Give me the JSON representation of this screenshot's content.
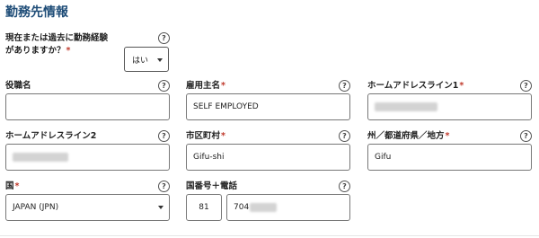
{
  "section": {
    "title": "勤務先情報"
  },
  "experience": {
    "label_line1": "現在または過去に勤務経験",
    "label_line2": "がありますか？",
    "required": "*",
    "value": "はい"
  },
  "fields": {
    "job_title": {
      "label": "役職名",
      "value": ""
    },
    "employer_name": {
      "label": "雇用主名",
      "required": "*",
      "value": "SELF EMPLOYED"
    },
    "address_line1": {
      "label": "ホームアドレスライン1",
      "required": "*"
    },
    "address_line2": {
      "label": "ホームアドレスライン2"
    },
    "city": {
      "label": "市区町村",
      "required": "*",
      "value": "Gifu-shi"
    },
    "state": {
      "label": "州／都道府県／地方",
      "required": "*",
      "value": "Gifu"
    },
    "country": {
      "label": "国",
      "required": "*",
      "value": "JAPAN (JPN)"
    },
    "phone": {
      "label": "国番号＋電話",
      "country_code": "81",
      "number_prefix": "704"
    }
  },
  "help_icon_glyph": "?",
  "icons": [
    "help-circle-icon",
    "chevron-down-icon"
  ]
}
